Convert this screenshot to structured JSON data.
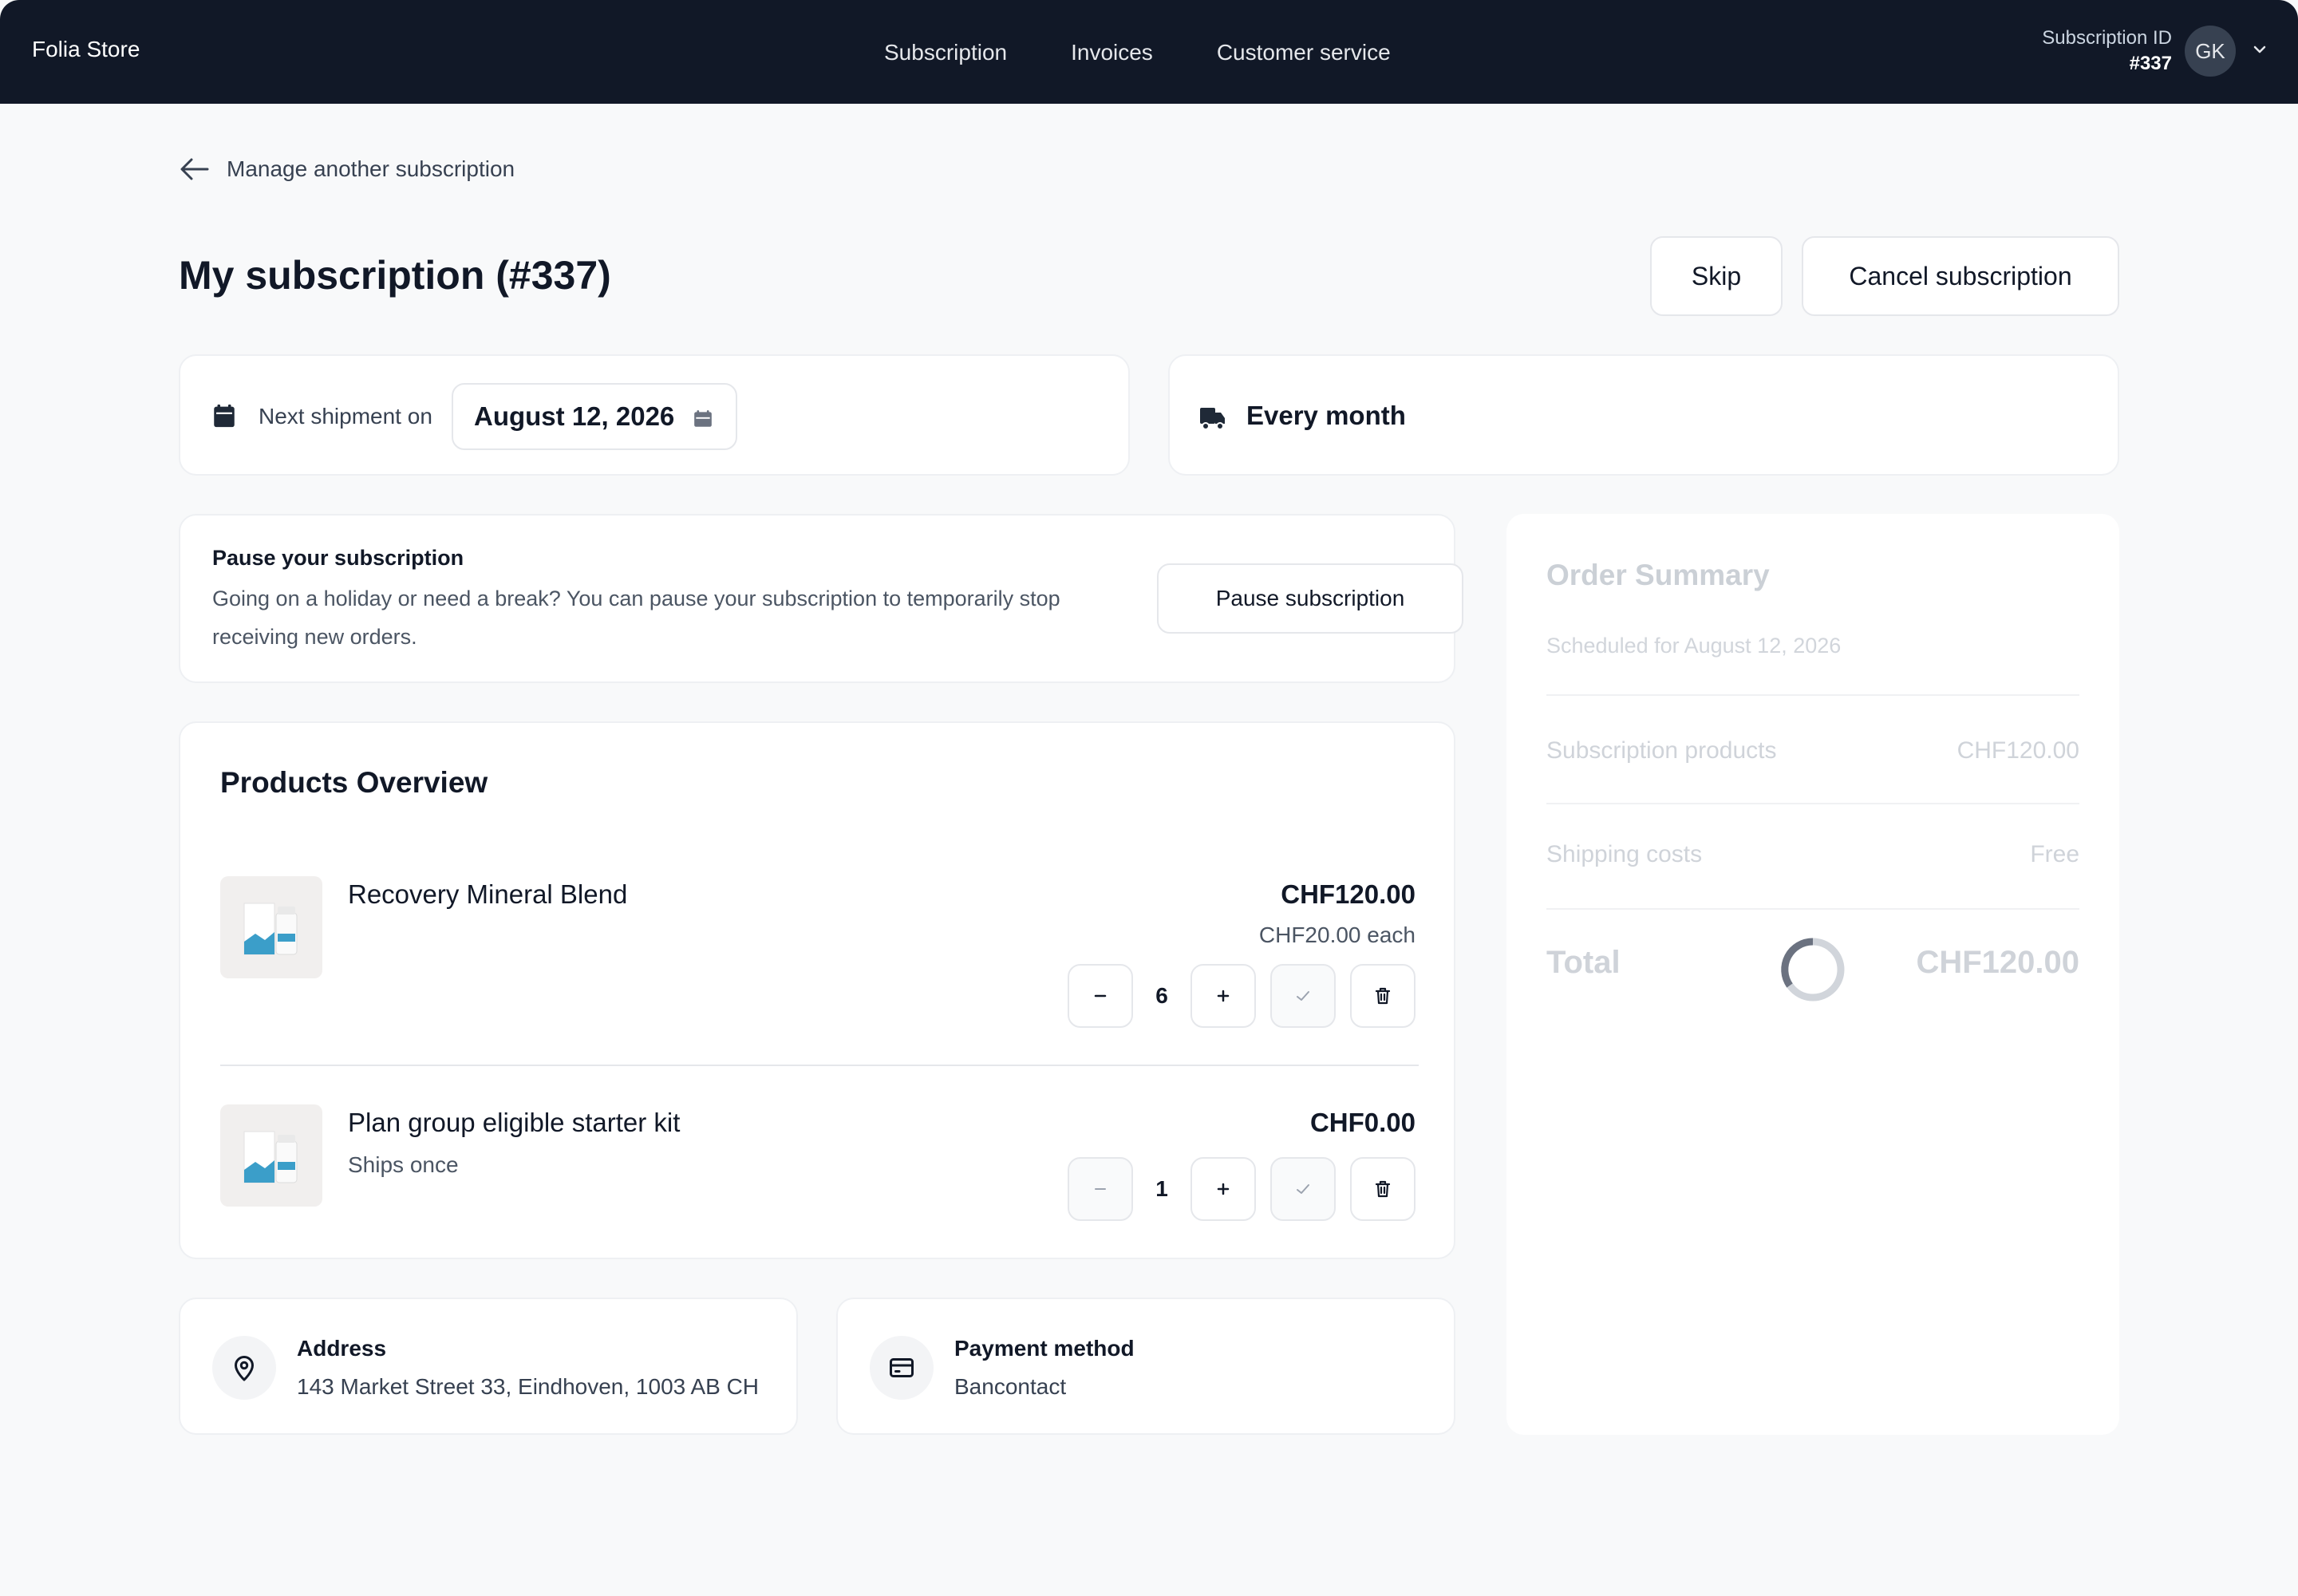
{
  "header": {
    "brand": "Folia Store",
    "nav": [
      "Subscription",
      "Invoices",
      "Customer service"
    ],
    "subscription_id_label": "Subscription ID",
    "subscription_id_value": "#337",
    "avatar_initials": "GK"
  },
  "back_link": "Manage another subscription",
  "page_title": "My subscription (#337)",
  "actions": {
    "skip": "Skip",
    "cancel": "Cancel subscription"
  },
  "shipment": {
    "label": "Next shipment on",
    "date": "August 12, 2026"
  },
  "frequency": {
    "label": "Every month"
  },
  "pause": {
    "title": "Pause your subscription",
    "description": "Going on a holiday or need a break? You can pause your subscription to temporarily stop receiving new orders.",
    "button": "Pause subscription"
  },
  "products": {
    "title": "Products Overview",
    "items": [
      {
        "name": "Recovery Mineral Blend",
        "price": "CHF120.00",
        "each": "CHF20.00 each",
        "quantity": "6"
      },
      {
        "name": "Plan group eligible starter kit",
        "subtitle": "Ships once",
        "price": "CHF0.00",
        "quantity": "1"
      }
    ]
  },
  "address": {
    "title": "Address",
    "value": "143 Market Street 33, Eindhoven, 1003 AB CH"
  },
  "payment": {
    "title": "Payment method",
    "value": "Bancontact"
  },
  "summary": {
    "title": "Order Summary",
    "scheduled": "Scheduled for August 12, 2026",
    "rows": [
      {
        "label": "Subscription products",
        "value": "CHF120.00"
      },
      {
        "label": "Shipping costs",
        "value": "Free"
      }
    ],
    "total_label": "Total",
    "total_value": "CHF120.00"
  },
  "icons": {
    "back": "arrow-left-icon",
    "calendar": "calendar-icon",
    "truck": "truck-icon",
    "minus": "minus-icon",
    "plus": "plus-icon",
    "check": "check-icon",
    "trash": "trash-icon",
    "location": "map-pin-icon",
    "card": "credit-card-icon",
    "chevron": "chevron-down-icon",
    "loading": "loading-spinner-icon"
  }
}
